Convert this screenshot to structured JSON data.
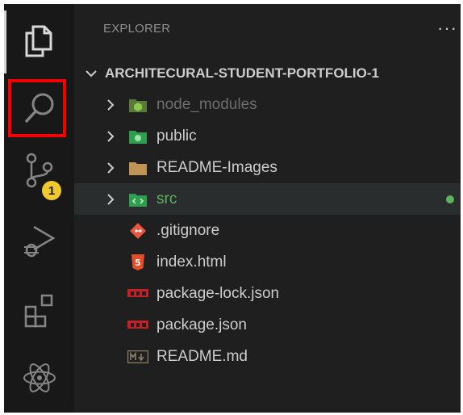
{
  "activitybar": {
    "items": [
      {
        "icon": "explorer-icon"
      },
      {
        "icon": "search-icon"
      },
      {
        "icon": "source-control-icon",
        "badge": "1"
      },
      {
        "icon": "run-debug-icon"
      },
      {
        "icon": "extensions-icon"
      },
      {
        "icon": "react-icon"
      }
    ],
    "highlight_color": "#f30000",
    "badge_color": "#f0c92f"
  },
  "explorer": {
    "title": "EXPLORER",
    "more": "···",
    "root": "ARCHITECURAL-STUDENT-PORTFOLIO-1",
    "items": [
      {
        "label": "node_modules",
        "type": "folder",
        "icon": "node-modules-folder-icon"
      },
      {
        "label": "public",
        "type": "folder",
        "icon": "public-folder-icon"
      },
      {
        "label": "README-Images",
        "type": "folder",
        "icon": "folder-icon"
      },
      {
        "label": "src",
        "type": "folder",
        "icon": "src-folder-icon"
      },
      {
        "label": ".gitignore",
        "type": "file",
        "icon": "git-icon"
      },
      {
        "label": "index.html",
        "type": "file",
        "icon": "html5-icon"
      },
      {
        "label": "package-lock.json",
        "type": "file",
        "icon": "npm-icon"
      },
      {
        "label": "package.json",
        "type": "file",
        "icon": "npm-icon"
      },
      {
        "label": "README.md",
        "type": "file",
        "icon": "markdown-icon"
      }
    ],
    "colors": {
      "muted": "#6e6e6e",
      "modified_green": "#5bb35c",
      "selected_bg": "#2a2d2e"
    }
  }
}
